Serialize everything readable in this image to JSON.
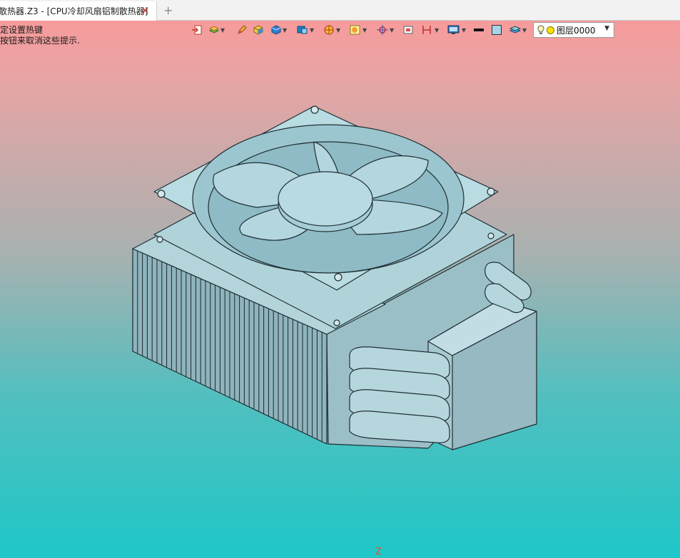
{
  "tab": {
    "title": "散热器.Z3 - [CPU冷却风扇铝制散热器]",
    "close_glyph": "✕"
  },
  "new_tab_glyph": "+",
  "hint": {
    "line1": "定设置热键",
    "line2": "按钮来取消这些提示."
  },
  "layer": {
    "label": "图层0000"
  },
  "axis": {
    "label": "Z"
  },
  "icons": [
    "import-icon",
    "layer-stack-icon",
    "pencil-icon",
    "cube-color-icon",
    "shaded-cube-icon",
    "cube-view-icon",
    "sphere-icon",
    "render-icon",
    "snap-target-icon",
    "frame-icon",
    "dimension-icon",
    "display-icon",
    "black-line-icon",
    "color-swatch-icon",
    "layer-icon",
    "bulb-icon"
  ],
  "colors": {
    "viewport_top": "#f79b9c",
    "viewport_bottom": "#1fc7c8",
    "model_face": "#a8cfd8"
  }
}
